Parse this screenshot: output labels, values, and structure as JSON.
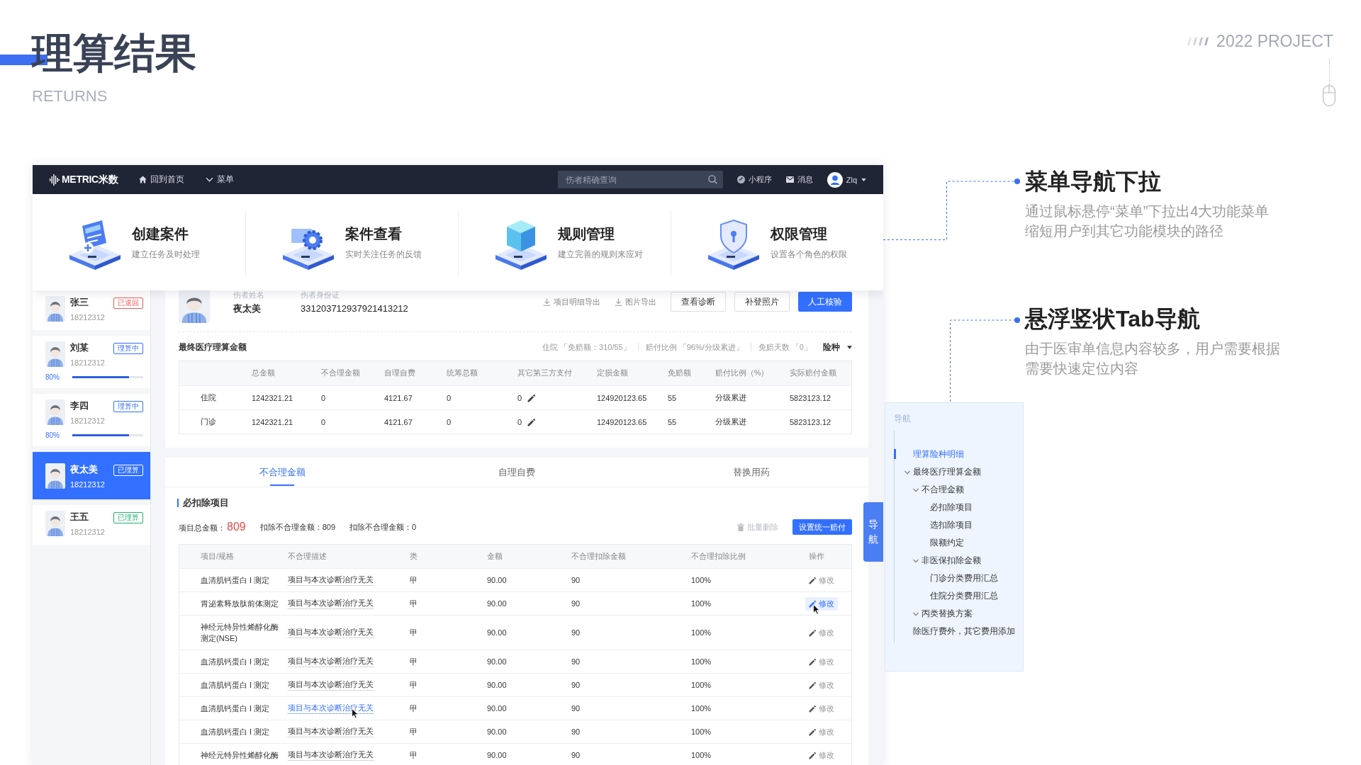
{
  "header": {
    "title": "理算结果",
    "subtitle": "RETURNS",
    "project": "2022 PROJECT"
  },
  "app": {
    "navbar": {
      "logo": "METRIC米数",
      "home": "回到首页",
      "menu": "菜单",
      "search": {
        "placeholder": "伤者精确查询"
      },
      "mini_program": "小程序",
      "messages": "消息",
      "user": "Zlq"
    },
    "menu": [
      {
        "title": "创建案件",
        "subtitle": "建立任务及时处理"
      },
      {
        "title": "案件查看",
        "subtitle": "实时关注任务的反馈"
      },
      {
        "title": "规则管理",
        "subtitle": "建立完善的规则来应对"
      },
      {
        "title": "权限管理",
        "subtitle": "设置各个角色的权限"
      }
    ],
    "patients": [
      {
        "name": "张三",
        "phone": "18212312",
        "status": "已退回",
        "color": "#f25656",
        "selected": false
      },
      {
        "name": "刘某",
        "phone": "18212312",
        "status": "理算中",
        "color": "#3370ff",
        "selected": false,
        "level": 0.8,
        "reading": "80%"
      },
      {
        "name": "李四",
        "phone": "18212312",
        "status": "理算中",
        "color": "#3370ff",
        "selected": false,
        "level": 0.8,
        "reading": "80%"
      },
      {
        "name": "夜太美",
        "phone": "18212312",
        "status": "已理算",
        "selected": true
      },
      {
        "name": "王五",
        "phone": "18212312",
        "status": "已理算",
        "color": "#22b26b",
        "selected": false
      }
    ],
    "patient_card": {
      "name_label": "伤者姓名",
      "name": "夜太美",
      "id_label": "伤者身份证",
      "id_number": "331203712937921413212",
      "actions": [
        {
          "label": "项目明细导出",
          "kind": "link"
        },
        {
          "label": "图片导出",
          "kind": "link"
        },
        {
          "label": "查看诊断",
          "kind": "default"
        },
        {
          "label": "补登照片",
          "kind": "default"
        },
        {
          "label": "人工核验",
          "kind": "primary"
        }
      ]
    },
    "final_amount": {
      "title": "最终医疗理算金额",
      "filters": [
        "住院 「免赔额：310/55」",
        "赔付比例 「96%/分级累进」",
        "免赔天数 「0」"
      ],
      "insurance": "险种",
      "table": {
        "columns": [
          "总金额",
          "不合理金额",
          "自理自费",
          "统筹总额",
          "其它第三方支付",
          "定损金额",
          "免赔额",
          "赔付比例（%）",
          "实际赔付金额"
        ],
        "rows": [
          {
            "label": "住院",
            "cells": [
              "1242321.21",
              "0",
              "4121.67",
              "0",
              "0",
              "124920123.65",
              "55",
              "分级累进",
              "5823123.12"
            ]
          },
          {
            "label": "门诊",
            "cells": [
              "1242321.21",
              "0",
              "4121.67",
              "0",
              "0",
              "124920123.65",
              "55",
              "分级累进",
              "5823123.12"
            ]
          }
        ]
      }
    },
    "detail": {
      "tabs": [
        {
          "label": "不合理金额",
          "selected": true
        },
        {
          "label": "自理自费",
          "selected": false
        },
        {
          "label": "替换用药",
          "selected": false
        }
      ],
      "section_title": "必扣除项目",
      "summary": [
        {
          "label": "项目总金额：",
          "value": "809",
          "kind": "highlight"
        },
        {
          "label": "扣除不合理金额：",
          "value": "809",
          "kind": "plain"
        },
        {
          "label": "扣除不合理金额：",
          "value": "0",
          "kind": "plain"
        }
      ],
      "batch_delete": {
        "label": "批量删除",
        "disabled": true
      },
      "set_payment": "设置统一赔付",
      "table": {
        "columns": [
          "项目/规格",
          "不合理描述",
          "类",
          "金额",
          "不合理扣除金额",
          "不合理扣除比例",
          "操作"
        ],
        "rows": [
          {
            "item": "血清肌钙蛋白 I 测定",
            "description": "项目与本次诊断治疗无关",
            "class": "甲",
            "amount": "90.00",
            "deduction": "90",
            "ratio": "100%",
            "action": "修改",
            "action_hovered": false,
            "description_hovered": false
          },
          {
            "item": "胃泌素释放肽前体测定",
            "description": "项目与本次诊断治疗无关",
            "class": "甲",
            "amount": "90.00",
            "deduction": "90",
            "ratio": "100%",
            "action": "修改",
            "action_hovered": true,
            "description_hovered": false
          },
          {
            "item": "神经元特异性烯醇化酶测定(NSE)",
            "description": "项目与本次诊断治疗无关",
            "class": "甲",
            "amount": "90.00",
            "deduction": "90",
            "ratio": "100%",
            "action": "修改",
            "action_hovered": false,
            "description_hovered": false
          },
          {
            "item": "血清肌钙蛋白 I 测定",
            "description": "项目与本次诊断治疗无关",
            "class": "甲",
            "amount": "90.00",
            "deduction": "90",
            "ratio": "100%",
            "action": "修改",
            "action_hovered": false,
            "description_hovered": false
          },
          {
            "item": "血清肌钙蛋白 I 测定",
            "description": "项目与本次诊断治疗无关",
            "class": "甲",
            "amount": "90.00",
            "deduction": "90",
            "ratio": "100%",
            "action": "修改",
            "action_hovered": false,
            "description_hovered": false
          },
          {
            "item": "血清肌钙蛋白 I 测定",
            "description": "项目与本次诊断治疗无关",
            "class": "甲",
            "amount": "90.00",
            "deduction": "90",
            "ratio": "100%",
            "action": "修改",
            "action_hovered": false,
            "description_hovered": true
          },
          {
            "item": "血清肌钙蛋白 I 测定",
            "description": "项目与本次诊断治疗无关",
            "class": "甲",
            "amount": "90.00",
            "deduction": "90",
            "ratio": "100%",
            "action": "修改",
            "action_hovered": false,
            "description_hovered": false
          },
          {
            "item": "神经元特异性烯醇化酶",
            "description": "项目与本次诊断治疗无关",
            "class": "甲",
            "amount": "90.00",
            "deduction": "90",
            "ratio": "100%",
            "action": "修改",
            "action_hovered": false,
            "description_hovered": false
          }
        ]
      }
    },
    "nav_tab": "导航"
  },
  "annotations": [
    {
      "title": "菜单导航下拉",
      "description_lines": [
        "通过鼠标悬停“菜单”下拉出4大功能菜单",
        "缩短用户到其它功能模块的路径"
      ]
    },
    {
      "title": "悬浮竖状Tab导航",
      "description_lines": [
        "由于医审单信息内容较多，用户需要根据",
        "需要快速定位内容"
      ]
    }
  ],
  "nav_panel": {
    "title": "导航",
    "items": [
      {
        "label": "理算险种明细",
        "selected": true
      },
      {
        "label": "最终医疗理算金额",
        "selected": false,
        "expanded": true,
        "children": [
          {
            "label": "不合理金额",
            "selected": false,
            "expanded": true,
            "children": [
              {
                "label": "必扣除项目",
                "selected": false
              },
              {
                "label": "选扣除项目",
                "selected": false
              },
              {
                "label": "限额约定",
                "selected": false
              }
            ]
          },
          {
            "label": "非医保扣除金额",
            "selected": false,
            "expanded": true,
            "children": [
              {
                "label": "门诊分类费用汇总",
                "selected": false
              },
              {
                "label": "住院分类费用汇总",
                "selected": false
              }
            ]
          },
          {
            "label": "丙类替换方案",
            "selected": false,
            "expanded": true
          }
        ]
      },
      {
        "label": "除医疗费外，其它费用添加",
        "selected": false
      }
    ]
  }
}
